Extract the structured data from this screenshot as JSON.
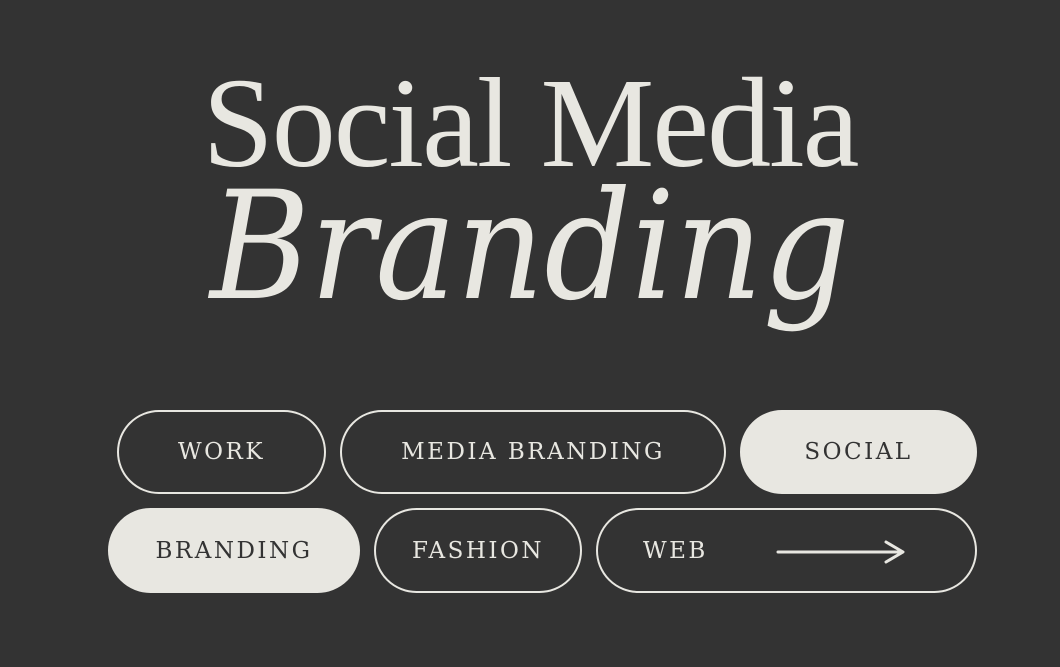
{
  "heading": {
    "line1": "Social Media",
    "line2": "Branding"
  },
  "tags": {
    "work": "WORK",
    "media_branding": "MEDIA BRANDING",
    "social": "SOCIAL",
    "branding": "BRANDING",
    "fashion": "FASHION",
    "web": "WEB"
  },
  "icons": {
    "arrow": "arrow-right-icon"
  },
  "colors": {
    "background": "#333333",
    "foreground": "#e8e7e1"
  }
}
